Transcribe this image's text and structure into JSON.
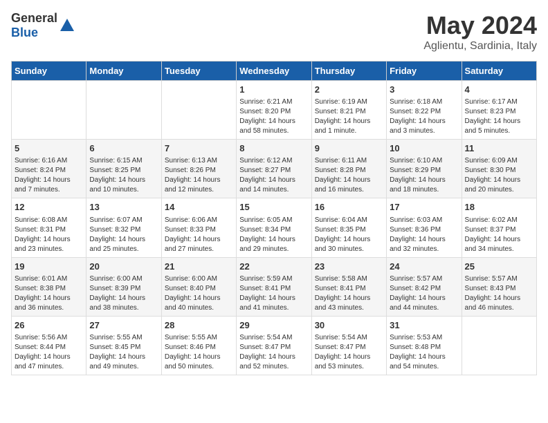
{
  "header": {
    "logo_general": "General",
    "logo_blue": "Blue",
    "month": "May 2024",
    "location": "Aglientu, Sardinia, Italy"
  },
  "days_of_week": [
    "Sunday",
    "Monday",
    "Tuesday",
    "Wednesday",
    "Thursday",
    "Friday",
    "Saturday"
  ],
  "weeks": [
    [
      {
        "day": "",
        "sunrise": "",
        "sunset": "",
        "daylight": ""
      },
      {
        "day": "",
        "sunrise": "",
        "sunset": "",
        "daylight": ""
      },
      {
        "day": "",
        "sunrise": "",
        "sunset": "",
        "daylight": ""
      },
      {
        "day": "1",
        "sunrise": "Sunrise: 6:21 AM",
        "sunset": "Sunset: 8:20 PM",
        "daylight": "Daylight: 14 hours and 58 minutes."
      },
      {
        "day": "2",
        "sunrise": "Sunrise: 6:19 AM",
        "sunset": "Sunset: 8:21 PM",
        "daylight": "Daylight: 14 hours and 1 minute."
      },
      {
        "day": "3",
        "sunrise": "Sunrise: 6:18 AM",
        "sunset": "Sunset: 8:22 PM",
        "daylight": "Daylight: 14 hours and 3 minutes."
      },
      {
        "day": "4",
        "sunrise": "Sunrise: 6:17 AM",
        "sunset": "Sunset: 8:23 PM",
        "daylight": "Daylight: 14 hours and 5 minutes."
      }
    ],
    [
      {
        "day": "5",
        "sunrise": "Sunrise: 6:16 AM",
        "sunset": "Sunset: 8:24 PM",
        "daylight": "Daylight: 14 hours and 7 minutes."
      },
      {
        "day": "6",
        "sunrise": "Sunrise: 6:15 AM",
        "sunset": "Sunset: 8:25 PM",
        "daylight": "Daylight: 14 hours and 10 minutes."
      },
      {
        "day": "7",
        "sunrise": "Sunrise: 6:13 AM",
        "sunset": "Sunset: 8:26 PM",
        "daylight": "Daylight: 14 hours and 12 minutes."
      },
      {
        "day": "8",
        "sunrise": "Sunrise: 6:12 AM",
        "sunset": "Sunset: 8:27 PM",
        "daylight": "Daylight: 14 hours and 14 minutes."
      },
      {
        "day": "9",
        "sunrise": "Sunrise: 6:11 AM",
        "sunset": "Sunset: 8:28 PM",
        "daylight": "Daylight: 14 hours and 16 minutes."
      },
      {
        "day": "10",
        "sunrise": "Sunrise: 6:10 AM",
        "sunset": "Sunset: 8:29 PM",
        "daylight": "Daylight: 14 hours and 18 minutes."
      },
      {
        "day": "11",
        "sunrise": "Sunrise: 6:09 AM",
        "sunset": "Sunset: 8:30 PM",
        "daylight": "Daylight: 14 hours and 20 minutes."
      }
    ],
    [
      {
        "day": "12",
        "sunrise": "Sunrise: 6:08 AM",
        "sunset": "Sunset: 8:31 PM",
        "daylight": "Daylight: 14 hours and 23 minutes."
      },
      {
        "day": "13",
        "sunrise": "Sunrise: 6:07 AM",
        "sunset": "Sunset: 8:32 PM",
        "daylight": "Daylight: 14 hours and 25 minutes."
      },
      {
        "day": "14",
        "sunrise": "Sunrise: 6:06 AM",
        "sunset": "Sunset: 8:33 PM",
        "daylight": "Daylight: 14 hours and 27 minutes."
      },
      {
        "day": "15",
        "sunrise": "Sunrise: 6:05 AM",
        "sunset": "Sunset: 8:34 PM",
        "daylight": "Daylight: 14 hours and 29 minutes."
      },
      {
        "day": "16",
        "sunrise": "Sunrise: 6:04 AM",
        "sunset": "Sunset: 8:35 PM",
        "daylight": "Daylight: 14 hours and 30 minutes."
      },
      {
        "day": "17",
        "sunrise": "Sunrise: 6:03 AM",
        "sunset": "Sunset: 8:36 PM",
        "daylight": "Daylight: 14 hours and 32 minutes."
      },
      {
        "day": "18",
        "sunrise": "Sunrise: 6:02 AM",
        "sunset": "Sunset: 8:37 PM",
        "daylight": "Daylight: 14 hours and 34 minutes."
      }
    ],
    [
      {
        "day": "19",
        "sunrise": "Sunrise: 6:01 AM",
        "sunset": "Sunset: 8:38 PM",
        "daylight": "Daylight: 14 hours and 36 minutes."
      },
      {
        "day": "20",
        "sunrise": "Sunrise: 6:00 AM",
        "sunset": "Sunset: 8:39 PM",
        "daylight": "Daylight: 14 hours and 38 minutes."
      },
      {
        "day": "21",
        "sunrise": "Sunrise: 6:00 AM",
        "sunset": "Sunset: 8:40 PM",
        "daylight": "Daylight: 14 hours and 40 minutes."
      },
      {
        "day": "22",
        "sunrise": "Sunrise: 5:59 AM",
        "sunset": "Sunset: 8:41 PM",
        "daylight": "Daylight: 14 hours and 41 minutes."
      },
      {
        "day": "23",
        "sunrise": "Sunrise: 5:58 AM",
        "sunset": "Sunset: 8:41 PM",
        "daylight": "Daylight: 14 hours and 43 minutes."
      },
      {
        "day": "24",
        "sunrise": "Sunrise: 5:57 AM",
        "sunset": "Sunset: 8:42 PM",
        "daylight": "Daylight: 14 hours and 44 minutes."
      },
      {
        "day": "25",
        "sunrise": "Sunrise: 5:57 AM",
        "sunset": "Sunset: 8:43 PM",
        "daylight": "Daylight: 14 hours and 46 minutes."
      }
    ],
    [
      {
        "day": "26",
        "sunrise": "Sunrise: 5:56 AM",
        "sunset": "Sunset: 8:44 PM",
        "daylight": "Daylight: 14 hours and 47 minutes."
      },
      {
        "day": "27",
        "sunrise": "Sunrise: 5:55 AM",
        "sunset": "Sunset: 8:45 PM",
        "daylight": "Daylight: 14 hours and 49 minutes."
      },
      {
        "day": "28",
        "sunrise": "Sunrise: 5:55 AM",
        "sunset": "Sunset: 8:46 PM",
        "daylight": "Daylight: 14 hours and 50 minutes."
      },
      {
        "day": "29",
        "sunrise": "Sunrise: 5:54 AM",
        "sunset": "Sunset: 8:47 PM",
        "daylight": "Daylight: 14 hours and 52 minutes."
      },
      {
        "day": "30",
        "sunrise": "Sunrise: 5:54 AM",
        "sunset": "Sunset: 8:47 PM",
        "daylight": "Daylight: 14 hours and 53 minutes."
      },
      {
        "day": "31",
        "sunrise": "Sunrise: 5:53 AM",
        "sunset": "Sunset: 8:48 PM",
        "daylight": "Daylight: 14 hours and 54 minutes."
      },
      {
        "day": "",
        "sunrise": "",
        "sunset": "",
        "daylight": ""
      }
    ]
  ]
}
